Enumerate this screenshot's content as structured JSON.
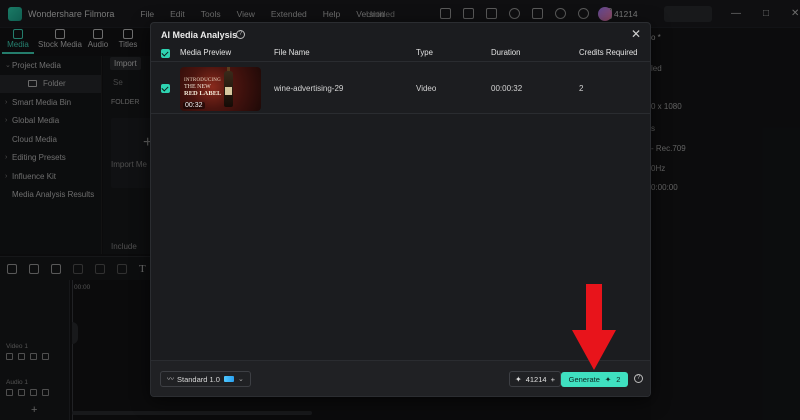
{
  "app": {
    "name": "Wondershare Filmora",
    "menu": [
      "File",
      "Edit",
      "Tools",
      "View",
      "Extended",
      "Help",
      "Version"
    ],
    "doc_title": "Untitled",
    "credits": "41214",
    "window_controls": [
      "—",
      "□",
      "✕"
    ],
    "brand_color": "#2fd4b0"
  },
  "media_tabs": [
    "Media",
    "Stock Media",
    "Audio",
    "Titles"
  ],
  "sidebar": {
    "items": [
      {
        "label": "Project Media",
        "chevron": "⌄"
      },
      {
        "label": "Folder",
        "chevron": ""
      },
      {
        "label": "Smart Media Bin",
        "chevron": "›"
      },
      {
        "label": "Global Media",
        "chevron": "›"
      },
      {
        "label": "Cloud Media",
        "chevron": ""
      },
      {
        "label": "Editing Presets",
        "chevron": "›"
      },
      {
        "label": "Influence Kit",
        "chevron": "›"
      },
      {
        "label": "Media Analysis Results",
        "chevron": ""
      }
    ]
  },
  "media_panel": {
    "import_label": "Import",
    "search_fragment": "Se",
    "folder_label": "FOLDER",
    "import_media_label": "Import Me",
    "include_label": "Include"
  },
  "timeline": {
    "ruler_time": "00:00",
    "tracks": [
      {
        "label": "Video 1"
      },
      {
        "label": "Audio 1"
      }
    ]
  },
  "right_panel": {
    "header": "o *",
    "lines": [
      "led",
      "0 x 1080",
      "s",
      "- Rec.709",
      "0Hz",
      "0:00:00"
    ]
  },
  "dialog": {
    "title": "AI Media Analysis",
    "columns": {
      "preview": "Media Preview",
      "file_name": "File Name",
      "type": "Type",
      "duration": "Duration",
      "credits": "Credits Required"
    },
    "rows": [
      {
        "checked": true,
        "thumb_duration": "00:32",
        "thumb_text": [
          "INTRODUCING",
          "THE NEW",
          "RED LABEL"
        ],
        "file_name": "wine-advertising-29",
        "type": "Video",
        "duration": "00:00:32",
        "credits": "2"
      }
    ],
    "footer": {
      "model_label": "Standard 1.0",
      "credits_available": "41214",
      "generate_label": "Generate",
      "generate_cost": "2"
    }
  },
  "annotation": {
    "arrow_color": "#e8141b"
  }
}
